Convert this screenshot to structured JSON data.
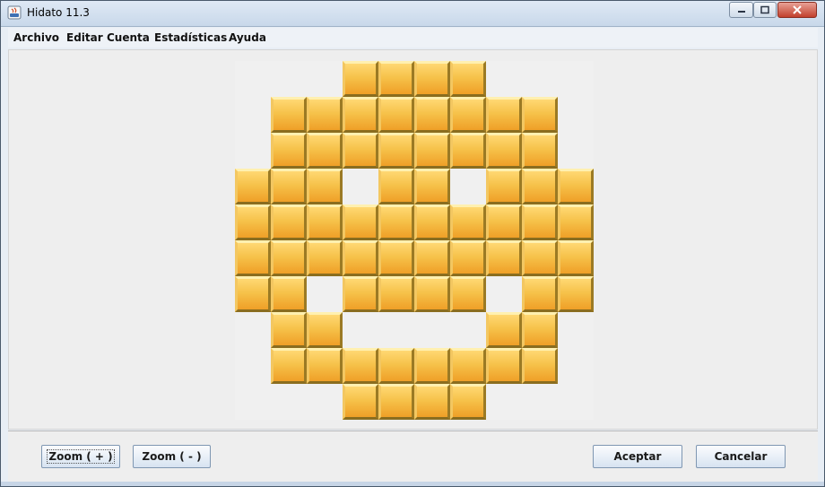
{
  "window": {
    "title": "Hidato 11.3"
  },
  "menu": [
    "Archivo",
    "Editar",
    "Cuenta",
    "Estadísticas",
    "Ayuda"
  ],
  "buttons": {
    "zoom_in": "Zoom ( + )",
    "zoom_out": "Zoom ( - )",
    "accept": "Aceptar",
    "cancel": "Cancelar"
  },
  "board": {
    "rows": 10,
    "cols": 10,
    "tile_color": "#f6c24a",
    "mask": [
      "...####...",
      ".########.",
      ".########.",
      "###.##.###",
      "##########",
      "##########",
      "##.####.##",
      ".##....##.",
      ".########.",
      "...####..."
    ]
  }
}
